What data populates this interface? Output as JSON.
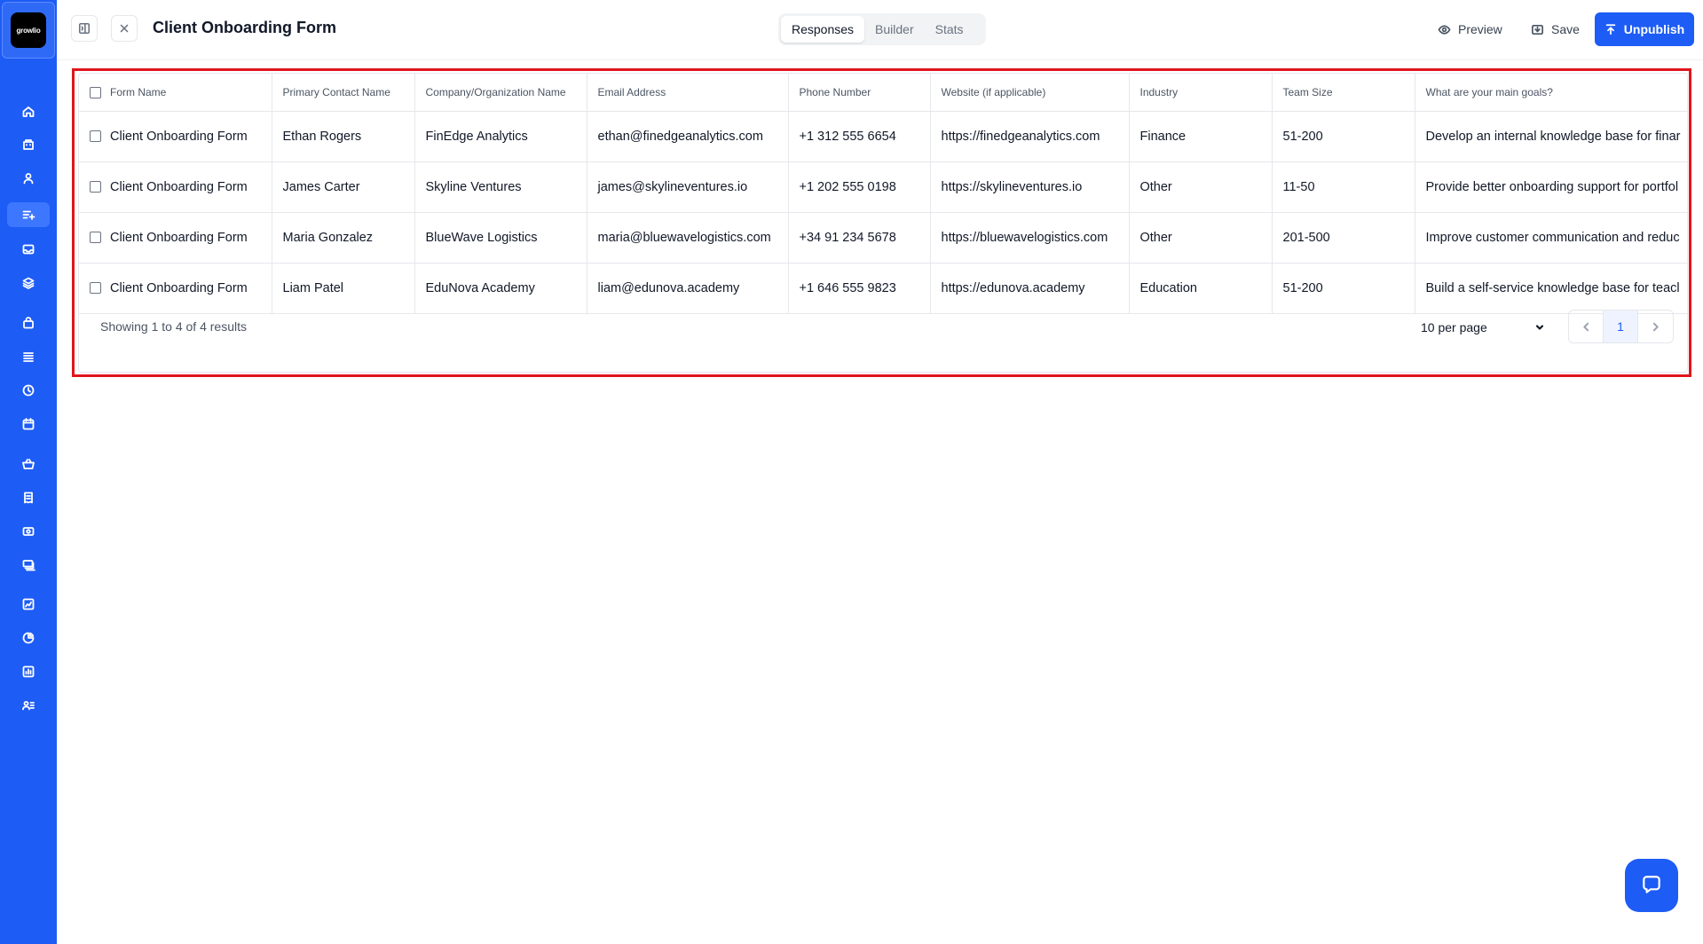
{
  "app": {
    "logo_text": "growlio"
  },
  "sidebar": {
    "items": [
      {
        "icon": "home-icon"
      },
      {
        "icon": "buildings-icon"
      },
      {
        "icon": "user-icon"
      },
      {
        "icon": "form-list-icon",
        "active": true
      },
      {
        "icon": "inbox-icon"
      },
      {
        "icon": "layers-icon"
      },
      {
        "icon": "bag-icon"
      },
      {
        "icon": "list-icon"
      },
      {
        "icon": "clock-icon"
      },
      {
        "icon": "calendar-icon"
      },
      {
        "icon": "basket-icon"
      },
      {
        "icon": "receipt-icon"
      },
      {
        "icon": "coupon-icon"
      },
      {
        "icon": "stack-icon"
      },
      {
        "icon": "chart-icon"
      },
      {
        "icon": "pie-icon"
      },
      {
        "icon": "report-icon"
      },
      {
        "icon": "users-list-icon"
      }
    ]
  },
  "header": {
    "title": "Client Onboarding Form",
    "tabs": [
      {
        "label": "Responses",
        "active": true
      },
      {
        "label": "Builder"
      },
      {
        "label": "Stats"
      }
    ],
    "preview_label": "Preview",
    "save_label": "Save",
    "unpublish_label": "Unpublish"
  },
  "table": {
    "columns": [
      "Form Name",
      "Primary Contact Name",
      "Company/Organization Name",
      "Email Address",
      "Phone Number",
      "Website (if applicable)",
      "Industry",
      "Team Size",
      "What are your main goals?"
    ],
    "rows": [
      [
        "Client Onboarding Form",
        "Ethan Rogers",
        "FinEdge Analytics",
        "ethan@finedgeanalytics.com",
        "+1 312 555 6654",
        "https://finedgeanalytics.com",
        "Finance",
        "51-200",
        "Develop an internal knowledge base for finar"
      ],
      [
        "Client Onboarding Form",
        "James Carter",
        "Skyline Ventures",
        "james@skylineventures.io",
        "+1 202 555 0198",
        "https://skylineventures.io",
        "Other",
        "11-50",
        "Provide better onboarding support for portfol"
      ],
      [
        "Client Onboarding Form",
        "Maria Gonzalez",
        "BlueWave Logistics",
        "maria@bluewavelogistics.com",
        "+34 91 234 5678",
        "https://bluewavelogistics.com",
        "Other",
        "201-500",
        "Improve customer communication and reduc"
      ],
      [
        "Client Onboarding Form",
        "Liam Patel",
        "EduNova Academy",
        "liam@edunova.academy",
        "+1 646 555 9823",
        "https://edunova.academy",
        "Education",
        "51-200",
        "Build a self-service knowledge base for teacl"
      ]
    ]
  },
  "pagination": {
    "results_text": "Showing 1 to 4 of 4 results",
    "per_page": "10 per page",
    "current_page": "1"
  },
  "colors": {
    "brand": "#1d5cf5",
    "highlight": "#e0151d"
  }
}
